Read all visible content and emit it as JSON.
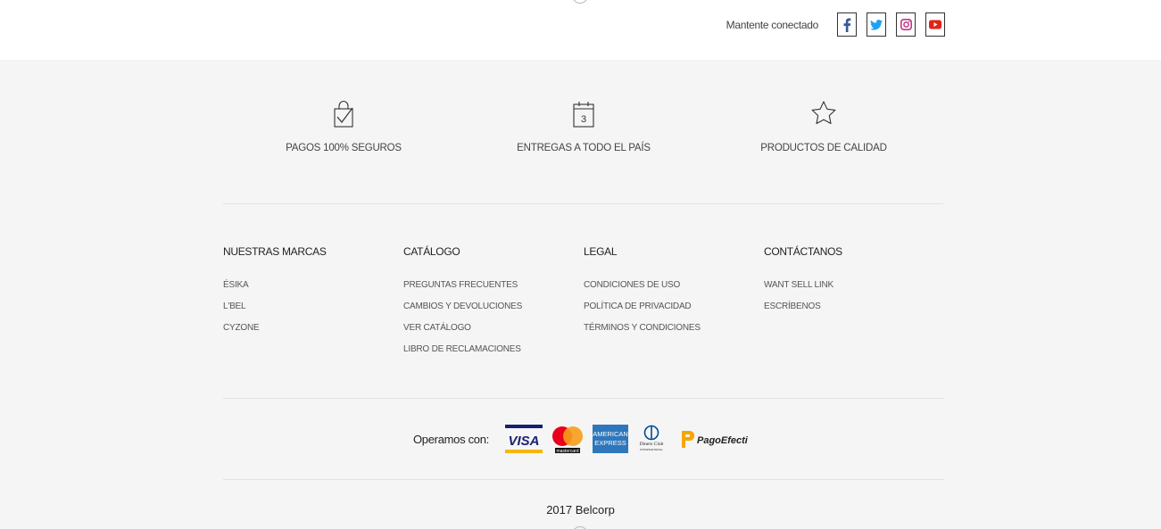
{
  "header": {
    "social_label": "Mantente conectado",
    "social": [
      {
        "name": "facebook",
        "icon": "facebook-icon",
        "color": "#3b5998"
      },
      {
        "name": "twitter",
        "icon": "twitter-icon",
        "color": "#1da1f2"
      },
      {
        "name": "instagram",
        "icon": "instagram-icon",
        "color": "#c13584"
      },
      {
        "name": "youtube",
        "icon": "youtube-icon",
        "color": "#e62117"
      }
    ]
  },
  "features": [
    {
      "label": "PAGOS 100% SEGUROS",
      "icon": "shopping-bag-check-icon"
    },
    {
      "label": "ENTREGAS A TODO EL PAÍS",
      "icon": "calendar-icon",
      "calendar_number": "3"
    },
    {
      "label": "PRODUCTOS DE CALIDAD",
      "icon": "star-icon"
    }
  ],
  "columns": [
    {
      "title": "NUESTRAS MARCAS",
      "items": [
        "ÉSIKA",
        "L'BEL",
        "CYZONE"
      ]
    },
    {
      "title": "CATÁLOGO",
      "items": [
        "PREGUNTAS FRECUENTES",
        "CAMBIOS Y DEVOLUCIONES",
        "VER CATÁLOGO",
        "LIBRO DE RECLAMACIONES"
      ]
    },
    {
      "title": "LEGAL",
      "items": [
        "CONDICIONES DE USO",
        "POLÍTICA DE PRIVACIDAD",
        "TÉRMINOS Y CONDICIONES"
      ]
    },
    {
      "title": "CONTÁCTANOS",
      "items": [
        "WANT SELL LINK",
        "ESCRÍBENOS"
      ]
    }
  ],
  "payments": {
    "label": "Operamos con:",
    "methods": [
      {
        "name": "visa",
        "text": "VISA",
        "color": "#1a1f71",
        "accent": "#f7b600"
      },
      {
        "name": "mastercard",
        "text": "mastercard",
        "color": "#eb001b",
        "accent": "#f79e1b"
      },
      {
        "name": "american-express",
        "text1": "AMERICAN",
        "text2": "EXPRESS",
        "color": "#2e77bc"
      },
      {
        "name": "diners-club",
        "text1": "Diners Club",
        "text2": "INTERNATIONAL",
        "color": "#004a97"
      },
      {
        "name": "pagoefectivo",
        "text": "PagoEfectivo",
        "color": "#f7a600"
      }
    ]
  },
  "copyright": "2017 Belcorp"
}
